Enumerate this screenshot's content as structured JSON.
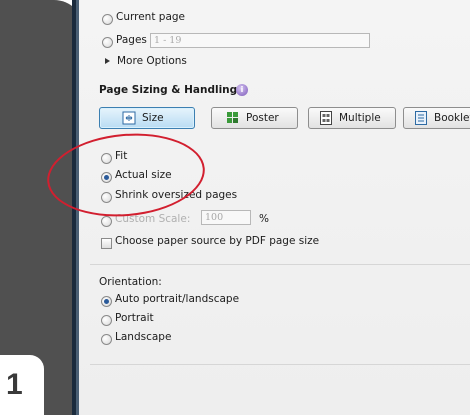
{
  "step_number": "1",
  "pages_to_print": {
    "current_page_label": "Current page",
    "pages_label": "Pages",
    "pages_value": "1 - 19",
    "more_options_label": "More Options"
  },
  "page_sizing": {
    "heading": "Page Sizing & Handling",
    "buttons": [
      {
        "label": "Size",
        "icon": "size-icon",
        "active": true
      },
      {
        "label": "Poster",
        "icon": "poster-icon",
        "active": false
      },
      {
        "label": "Multiple",
        "icon": "multiple-icon",
        "active": false
      },
      {
        "label": "Booklet",
        "icon": "booklet-icon",
        "active": false
      }
    ],
    "options": {
      "fit": "Fit",
      "actual_size": "Actual size",
      "shrink": "Shrink oversized pages",
      "custom_scale": "Custom Scale:",
      "custom_scale_value": "100",
      "percent": "%"
    },
    "selected": "actual_size",
    "paper_source_label": "Choose paper source by PDF page size",
    "paper_source_checked": false
  },
  "orientation": {
    "heading": "Orientation:",
    "options": [
      "Auto portrait/landscape",
      "Portrait",
      "Landscape"
    ],
    "selected_index": 0
  },
  "colors": {
    "annotation": "#d21f2f",
    "tab_card": "#505050",
    "active_button": "#b9dcf3"
  }
}
